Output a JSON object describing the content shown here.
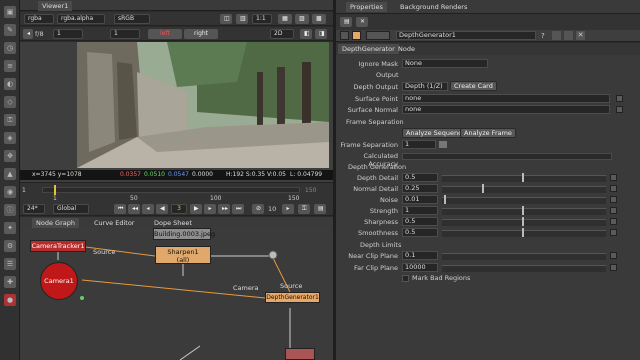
{
  "viewer": {
    "tab": "Viewer1",
    "channels": "rgba",
    "layer": "rgba.alpha",
    "colorspace": "sRGB",
    "zoom": "1:1",
    "fstop": "f/8",
    "gain": "1",
    "gamma": "1",
    "left_label": "left",
    "right_label": "right",
    "mode": "2D",
    "info": {
      "coords": "x=3745 y=1078",
      "r": "0.0357",
      "g": "0.0510",
      "b": "0.0547",
      "a": "0.0000",
      "hsl": "H:192 S:0.35 V:0.05",
      "lum": "L: 0.04799"
    },
    "timeline": {
      "start": "1",
      "ticks": [
        "1",
        "50",
        "100",
        "150"
      ],
      "end": "150"
    },
    "playback": {
      "fps": "24*",
      "scope": "Global",
      "frame": "3",
      "step": "10"
    }
  },
  "nodegraph": {
    "tabs": [
      "Node Graph",
      "Curve Editor",
      "Dope Sheet"
    ],
    "nodes": {
      "camera_tracker": "CameraTracker1",
      "camera": "Camera1",
      "read": "Building.0003.jpeg",
      "sharpen_line1": "Sharpen1",
      "sharpen_line2": "(all)",
      "depth": "DepthGenerator1"
    },
    "edge_labels": {
      "source1": "Source",
      "camera": "Camera",
      "source2": "Source"
    }
  },
  "properties": {
    "tabs": [
      "Properties",
      "Background Renders"
    ],
    "node_name": "DepthGenerator1",
    "subtabs": [
      "DepthGenerator",
      "Node"
    ],
    "ignore_mask_label": "Ignore Mask",
    "ignore_mask_value": "None",
    "output_section": "Output",
    "depth_output_label": "Depth Output",
    "depth_output_value": "Depth (1/Z)",
    "create_card": "Create Card",
    "surface_point_label": "Surface Point",
    "surface_point_value": "none",
    "surface_normal_label": "Surface Normal",
    "surface_normal_value": "none",
    "frame_sep_section": "Frame Separation",
    "analyze_sequence": "Analyze Sequence",
    "analyze_frame": "Analyze Frame",
    "frame_sep_label": "Frame Separation",
    "frame_sep_value": "1",
    "calc_accuracy_label": "Calculated Accuracy",
    "depth_gen_section": "Depth Generation",
    "params": [
      {
        "label": "Depth Detail",
        "value": "0.5",
        "pos": 0.5
      },
      {
        "label": "Normal Detail",
        "value": "0.25",
        "pos": 0.25
      },
      {
        "label": "Noise",
        "value": "0.01",
        "pos": 0.01
      },
      {
        "label": "Strength",
        "value": "1",
        "pos": 0.5
      },
      {
        "label": "Sharpness",
        "value": "0.5",
        "pos": 0.5
      },
      {
        "label": "Smoothness",
        "value": "0.5",
        "pos": 0.5
      }
    ],
    "depth_limits_section": "Depth Limits",
    "near_label": "Near Clip Plane",
    "near_value": "0.1",
    "far_label": "Far Clip Plane",
    "far_value": "10000",
    "mark_bad": "Mark Bad Regions"
  }
}
